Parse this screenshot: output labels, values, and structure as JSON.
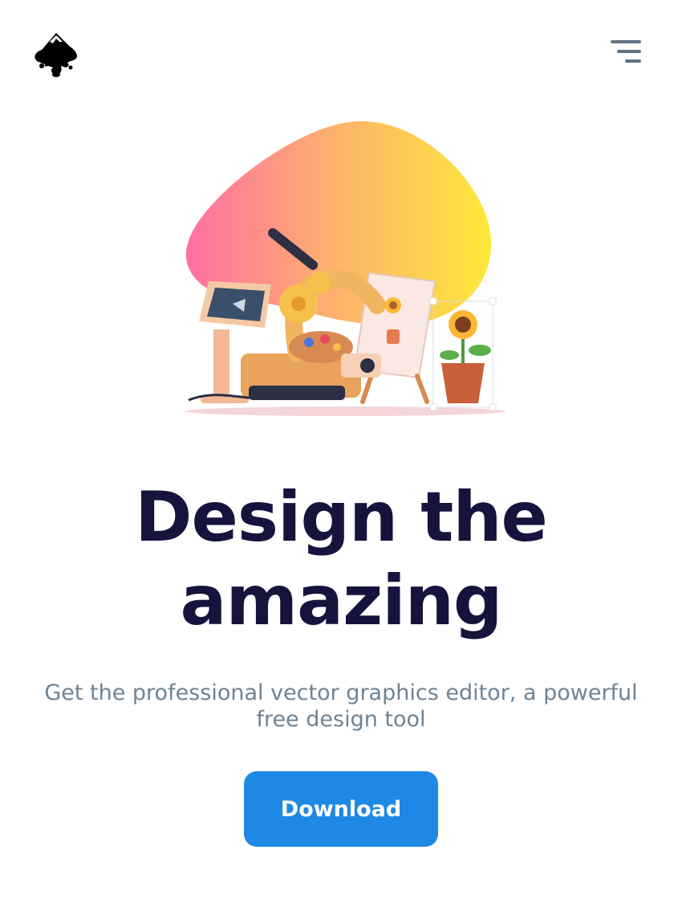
{
  "header": {
    "logo_icon": "inkscape-logo-icon",
    "menu_icon": "hamburger-menu-icon"
  },
  "hero": {
    "illustration": "robot-arm-drawing-illustration",
    "blob_colors": [
      "#ff6fa3",
      "#fdb36b",
      "#ffe83a"
    ],
    "headline_line1": "Design the",
    "headline_line2": "amazing",
    "subtitle": "Get the professional vector graphics editor, a powerful free design tool",
    "cta_label": "Download"
  },
  "colors": {
    "headline": "#16143d",
    "subtitle": "#6e8394",
    "cta_background": "#1e88e5",
    "menu_icon": "#5f7384"
  }
}
